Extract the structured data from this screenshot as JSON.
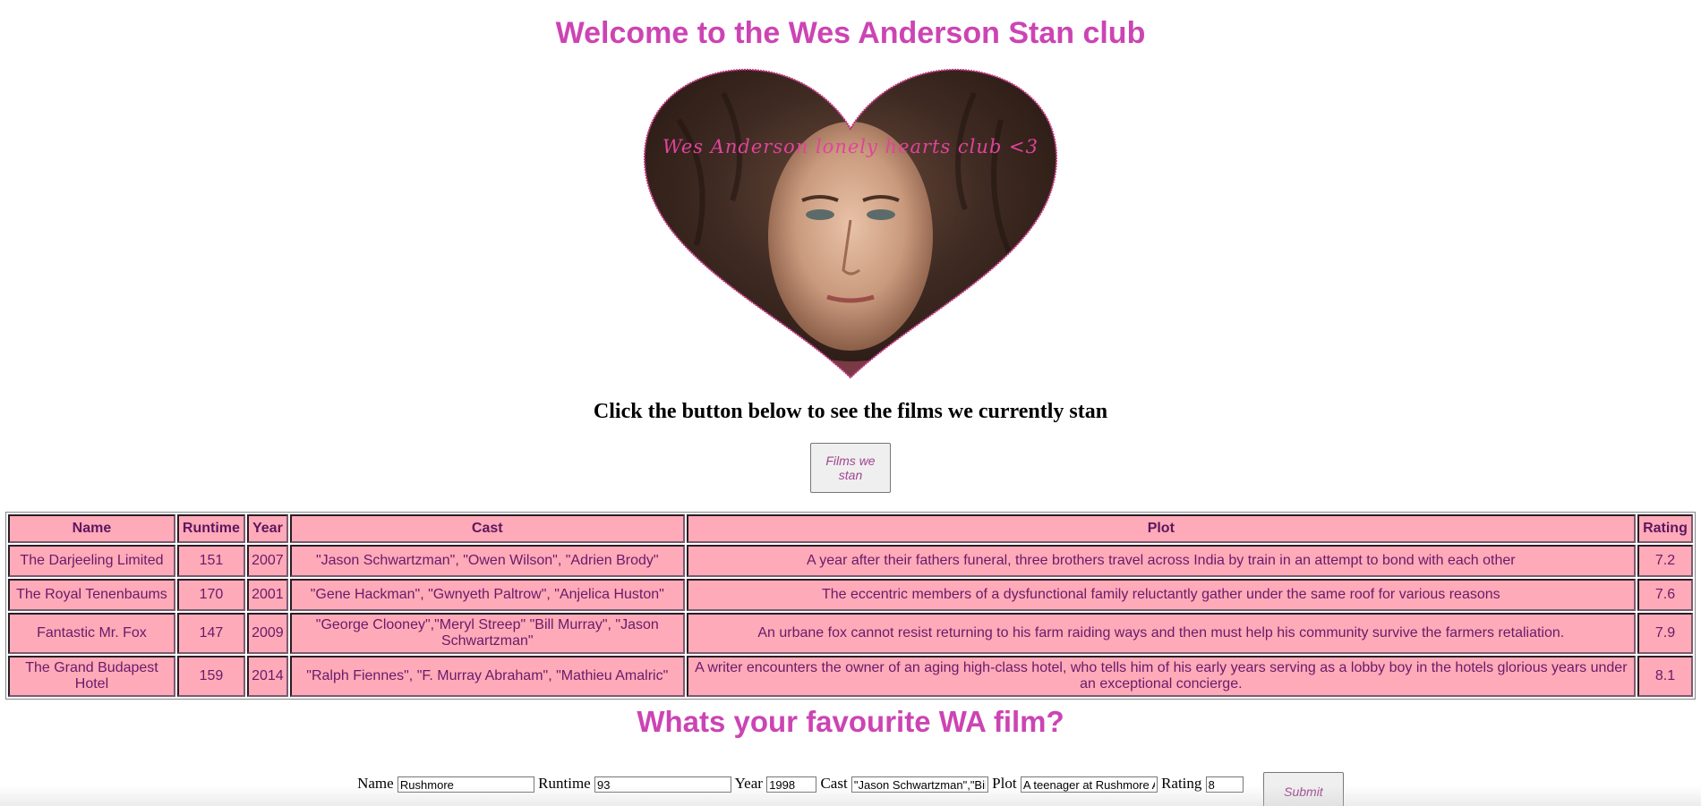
{
  "header": {
    "title": "Welcome to the Wes Anderson Stan club"
  },
  "hero": {
    "caption": "Wes Anderson lonely hearts club <3",
    "shape": "heart",
    "border_color": "#c0307a",
    "caption_color": "#e0449a"
  },
  "prompt": {
    "text": "Click the button below to see the films we currently stan",
    "button_label": "Films we stan"
  },
  "films_table": {
    "columns": [
      "Name",
      "Runtime",
      "Year",
      "Cast",
      "Plot",
      "Rating"
    ],
    "rows": [
      [
        "The Darjeeling Limited",
        "151",
        "2007",
        "\"Jason Schwartzman\", \"Owen Wilson\", \"Adrien Brody\"",
        "A year after their fathers funeral, three brothers travel across India by train in an attempt to bond with each other",
        "7.2"
      ],
      [
        "The Royal Tenenbaums",
        "170",
        "2001",
        "\"Gene Hackman\", \"Gwnyeth Paltrow\", \"Anjelica Huston\"",
        "The eccentric members of a dysfunctional family reluctantly gather under the same roof for various reasons",
        "7.6"
      ],
      [
        "Fantastic Mr. Fox",
        "147",
        "2009",
        "\"George Clooney\",\"Meryl Streep\" \"Bill Murray\", \"Jason Schwartzman\"",
        "An urbane fox cannot resist returning to his farm raiding ways and then must help his community survive the farmers retaliation.",
        "7.9"
      ],
      [
        "The Grand Budapest Hotel",
        "159",
        "2014",
        "\"Ralph Fiennes\", \"F. Murray Abraham\", \"Mathieu Amalric\"",
        "A writer encounters the owner of an aging high-class hotel, who tells him of his early years serving as a lobby boy in the hotels glorious years under an exceptional concierge.",
        "8.1"
      ]
    ],
    "cell_color": "#ffaab8",
    "text_color": "#6a1a6a"
  },
  "favourite": {
    "heading": "Whats your favourite WA film?",
    "fields": {
      "name_label": "Name",
      "name_value": "Rushmore",
      "runtime_label": "Runtime",
      "runtime_value": "93",
      "year_label": "Year",
      "year_value": "1998",
      "cast_label": "Cast",
      "cast_value": "\"Jason Schwartzman\",\"Bill Murray\"",
      "plot_label": "Plot",
      "plot_value": "A teenager at Rushmore Academy",
      "rating_label": "Rating",
      "rating_value": "8"
    },
    "submit_label": "Submit"
  },
  "colors": {
    "accent": "#cc44b4",
    "button_text": "#a04591"
  }
}
